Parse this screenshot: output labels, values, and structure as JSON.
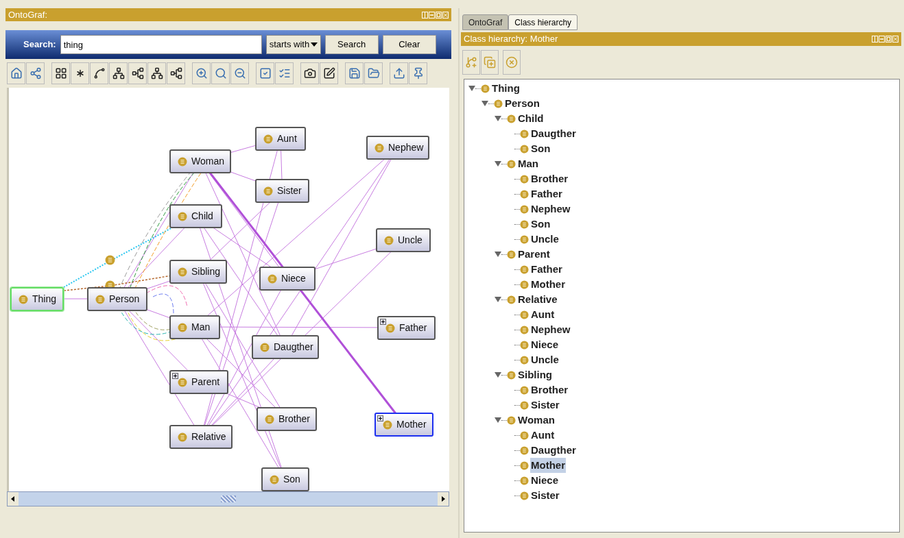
{
  "ontograf": {
    "title": "OntoGraf:",
    "search": {
      "label": "Search:",
      "value": "thing",
      "mode": "starts with",
      "buttons": [
        "Search",
        "Clear"
      ]
    },
    "nodes": [
      {
        "label": "Thing",
        "highlighted": true,
        "selected": false,
        "expandable": false
      },
      {
        "label": "Person",
        "highlighted": false,
        "selected": false,
        "expandable": false
      },
      {
        "label": "Woman",
        "highlighted": false,
        "selected": false,
        "expandable": false
      },
      {
        "label": "Aunt",
        "highlighted": false,
        "selected": false,
        "expandable": false
      },
      {
        "label": "Sister",
        "highlighted": false,
        "selected": false,
        "expandable": false
      },
      {
        "label": "Child",
        "highlighted": false,
        "selected": false,
        "expandable": false
      },
      {
        "label": "Sibling",
        "highlighted": false,
        "selected": false,
        "expandable": false
      },
      {
        "label": "Niece",
        "highlighted": false,
        "selected": false,
        "expandable": false
      },
      {
        "label": "Man",
        "highlighted": false,
        "selected": false,
        "expandable": false
      },
      {
        "label": "Daugther",
        "highlighted": false,
        "selected": false,
        "expandable": false
      },
      {
        "label": "Parent",
        "highlighted": false,
        "selected": false,
        "expandable": true
      },
      {
        "label": "Relative",
        "highlighted": false,
        "selected": false,
        "expandable": false
      },
      {
        "label": "Brother",
        "highlighted": false,
        "selected": false,
        "expandable": false
      },
      {
        "label": "Son",
        "highlighted": false,
        "selected": false,
        "expandable": false
      },
      {
        "label": "Nephew",
        "highlighted": false,
        "selected": false,
        "expandable": false
      },
      {
        "label": "Uncle",
        "highlighted": false,
        "selected": false,
        "expandable": false
      },
      {
        "label": "Father",
        "highlighted": false,
        "selected": false,
        "expandable": true
      },
      {
        "label": "Mother",
        "highlighted": false,
        "selected": true,
        "expandable": true
      }
    ]
  },
  "right_panel": {
    "tabs": [
      {
        "label": "OntoGraf",
        "selected": false
      },
      {
        "label": "Class hierarchy",
        "selected": true
      }
    ],
    "title": "Class hierarchy: Mother",
    "tree": [
      {
        "label": "Thing",
        "expanded": true,
        "selected": false,
        "children": [
          {
            "label": "Person",
            "expanded": true,
            "selected": false,
            "children": [
              {
                "label": "Child",
                "expanded": true,
                "selected": false,
                "children": [
                  {
                    "label": "Daugther",
                    "selected": false
                  },
                  {
                    "label": "Son",
                    "selected": false
                  }
                ]
              },
              {
                "label": "Man",
                "expanded": true,
                "selected": false,
                "children": [
                  {
                    "label": "Brother",
                    "selected": false
                  },
                  {
                    "label": "Father",
                    "selected": false
                  },
                  {
                    "label": "Nephew",
                    "selected": false
                  },
                  {
                    "label": "Son",
                    "selected": false
                  },
                  {
                    "label": "Uncle",
                    "selected": false
                  }
                ]
              },
              {
                "label": "Parent",
                "expanded": true,
                "selected": false,
                "children": [
                  {
                    "label": "Father",
                    "selected": false
                  },
                  {
                    "label": "Mother",
                    "selected": false
                  }
                ]
              },
              {
                "label": "Relative",
                "expanded": true,
                "selected": false,
                "children": [
                  {
                    "label": "Aunt",
                    "selected": false
                  },
                  {
                    "label": "Nephew",
                    "selected": false
                  },
                  {
                    "label": "Niece",
                    "selected": false
                  },
                  {
                    "label": "Uncle",
                    "selected": false
                  }
                ]
              },
              {
                "label": "Sibling",
                "expanded": true,
                "selected": false,
                "children": [
                  {
                    "label": "Brother",
                    "selected": false
                  },
                  {
                    "label": "Sister",
                    "selected": false
                  }
                ]
              },
              {
                "label": "Woman",
                "expanded": true,
                "selected": false,
                "children": [
                  {
                    "label": "Aunt",
                    "selected": false
                  },
                  {
                    "label": "Daugther",
                    "selected": false
                  },
                  {
                    "label": "Mother",
                    "selected": true
                  },
                  {
                    "label": "Niece",
                    "selected": false
                  },
                  {
                    "label": "Sister",
                    "selected": false
                  }
                ]
              }
            ]
          }
        ]
      }
    ]
  }
}
